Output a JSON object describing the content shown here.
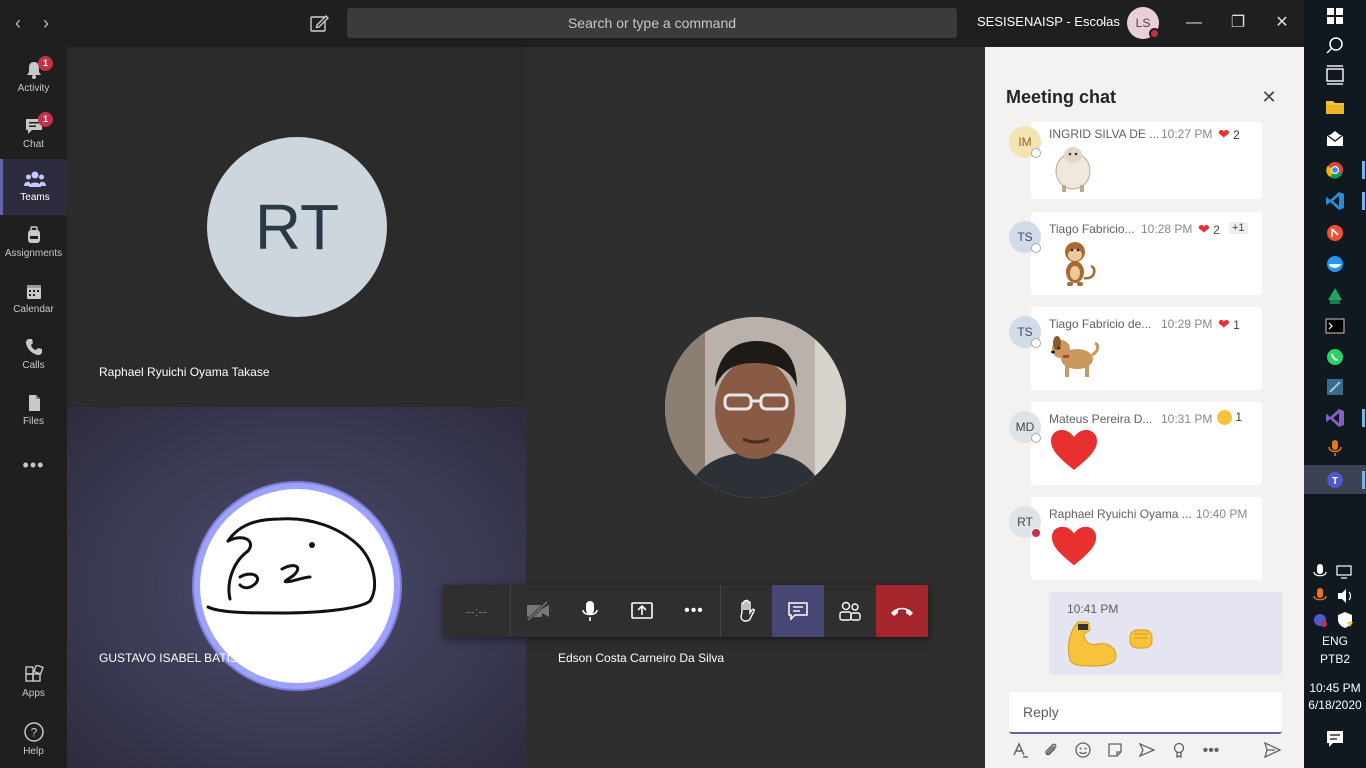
{
  "topbar": {
    "search_placeholder": "Search or type a command",
    "org_name": "SESISENAISP - Escolas",
    "user_initials": "LS"
  },
  "rail": {
    "items": [
      {
        "label": "Activity",
        "badge": "1"
      },
      {
        "label": "Chat",
        "badge": "1"
      },
      {
        "label": "Teams"
      },
      {
        "label": "Assignments"
      },
      {
        "label": "Calendar"
      },
      {
        "label": "Calls"
      },
      {
        "label": "Files"
      },
      {
        "label": "Apps"
      },
      {
        "label": "Help"
      }
    ]
  },
  "stage": {
    "tiles": [
      {
        "initials": "RT",
        "name": "Raphael Ryuichi Oyama Takase"
      },
      {
        "name": "GUSTAVO ISABEL BATISTA LIMA"
      },
      {
        "name": "Edson Costa Carneiro Da Silva"
      }
    ],
    "timer": "--:--"
  },
  "chat": {
    "title": "Meeting chat",
    "messages": [
      {
        "initials": "IM",
        "sender": "INGRID SILVA DE ...",
        "time": "10:27 PM",
        "reaction_count": "2",
        "avatar_color": "#f6e3b4"
      },
      {
        "initials": "TS",
        "sender": "Tiago Fabricio...",
        "time": "10:28 PM",
        "reaction_count": "2",
        "extra": "+1",
        "avatar_color": "#d3dae8"
      },
      {
        "initials": "TS",
        "sender": "Tiago Fabricio de...",
        "time": "10:29 PM",
        "reaction_count": "1",
        "avatar_color": "#d3dae8"
      },
      {
        "initials": "MD",
        "sender": "Mateus Pereira D...",
        "time": "10:31 PM",
        "reaction_count": "1",
        "avatar_color": "#dde3e7"
      },
      {
        "initials": "RT",
        "sender": "Raphael Ryuichi Oyama ...",
        "time": "10:40 PM",
        "avatar_color": "#dde3e7"
      }
    ],
    "my_message_time": "10:41 PM",
    "reply_placeholder": "Reply"
  },
  "taskbar": {
    "lang1": "ENG",
    "lang2": "PTB2",
    "time": "10:45 PM",
    "date": "6/18/2020"
  },
  "colors": {
    "accent": "#6264a7",
    "hangup": "#c4314b",
    "heart": "#e8312f"
  }
}
